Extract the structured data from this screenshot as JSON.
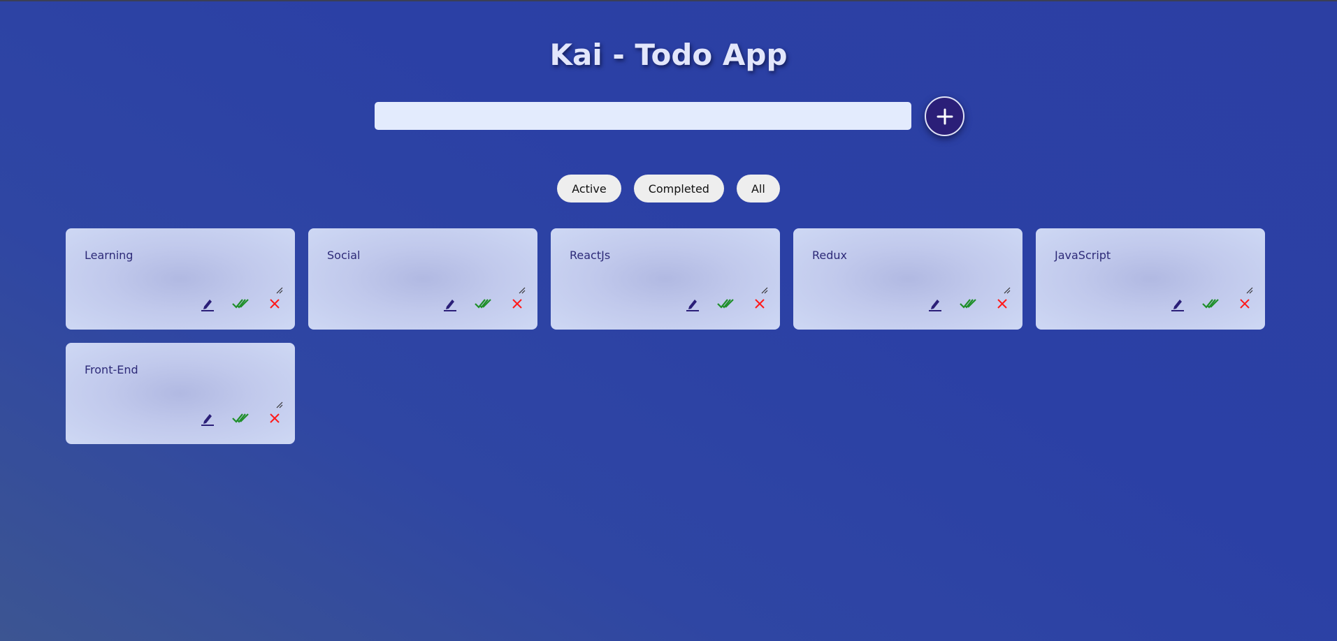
{
  "app": {
    "title": "Kai - Todo App"
  },
  "input": {
    "value": "",
    "placeholder": ""
  },
  "add_button": {
    "icon": "plus-icon"
  },
  "filters": [
    {
      "label": "Active"
    },
    {
      "label": "Completed"
    },
    {
      "label": "All"
    }
  ],
  "todos": [
    {
      "text": "Learning"
    },
    {
      "text": "Social"
    },
    {
      "text": "ReactJs"
    },
    {
      "text": "Redux"
    },
    {
      "text": "JavaScript"
    },
    {
      "text": "Front-End"
    }
  ],
  "actions": {
    "edit_icon": "pencil-icon",
    "complete_icon": "double-check-icon",
    "delete_icon": "close-icon"
  },
  "colors": {
    "background": "#2b40a5",
    "title": "#e2e6fb",
    "add_button": "#2b1f78",
    "card_text": "#2d2a78",
    "edit": "#2b1f78",
    "complete": "#1f8f2a",
    "delete": "#ff1a1a"
  }
}
